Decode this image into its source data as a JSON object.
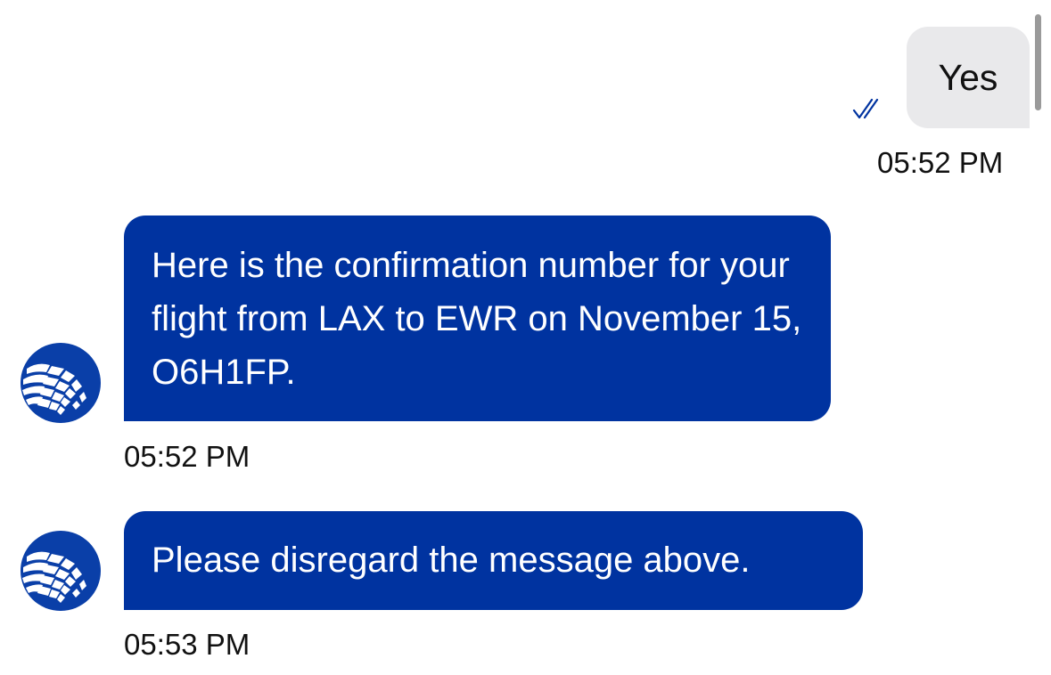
{
  "colors": {
    "agent_bubble": "#0033a0",
    "user_bubble": "#e9e9eb",
    "read_receipt": "#0033a0",
    "logo": "#0a3fa8"
  },
  "messages": [
    {
      "sender": "user",
      "text": "Yes",
      "time": "05:52 PM",
      "status_icon": "double-check-icon"
    },
    {
      "sender": "agent",
      "text": "Here is the confirmation number for your flight from LAX to EWR on November 15, O6H1FP.",
      "time": "05:52 PM",
      "avatar_icon": "globe-logo-icon"
    },
    {
      "sender": "agent",
      "text": "Please disregard the message above.",
      "time": "05:53 PM",
      "avatar_icon": "globe-logo-icon"
    }
  ]
}
